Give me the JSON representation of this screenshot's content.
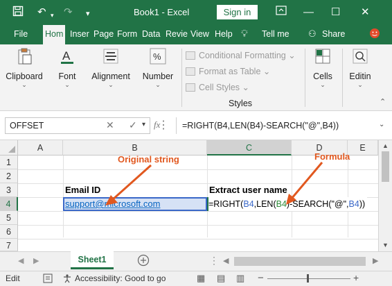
{
  "titlebar": {
    "title": "Book1  -  Excel",
    "signin": "Sign in"
  },
  "tabs": [
    "File",
    "Hom",
    "Inser",
    "Page",
    "Form",
    "Data",
    "Revie",
    "View",
    "Help"
  ],
  "tell_me": "Tell me",
  "share": "Share",
  "ribbon": {
    "clipboard": "Clipboard",
    "font": "Font",
    "alignment": "Alignment",
    "number": "Number",
    "conditional": "Conditional Formatting",
    "format_table": "Format as Table",
    "cell_styles": "Cell Styles",
    "styles_group": "Styles",
    "cells": "Cells",
    "editing": "Editin"
  },
  "formula_bar": {
    "name_box": "OFFSET",
    "fx": "fx",
    "formula": "=RIGHT(B4,LEN(B4)-SEARCH(\"@\",B4))"
  },
  "columns": [
    "A",
    "B",
    "C",
    "D",
    "E"
  ],
  "rows": [
    "1",
    "2",
    "3",
    "4",
    "5",
    "6",
    "7"
  ],
  "cells": {
    "B3": "Email ID",
    "C3": "Extract user name",
    "B4": "support@microsoft.com",
    "C4_parts": [
      "=RIGHT(",
      "B4",
      ",LEN(",
      "B4",
      ")-SEARCH(\"@\",",
      "B4",
      "))"
    ]
  },
  "annotations": {
    "original": "Original string",
    "formula": "Formula"
  },
  "sheet_tab": "Sheet1",
  "status": {
    "mode": "Edit",
    "accessibility": "Accessibility: Good to go"
  },
  "colors": {
    "excel_green": "#217346",
    "annotation": "#e1581f",
    "ref_blue": "#3a68c8",
    "ref_green": "#2e8b3a",
    "link": "#0563c1"
  }
}
